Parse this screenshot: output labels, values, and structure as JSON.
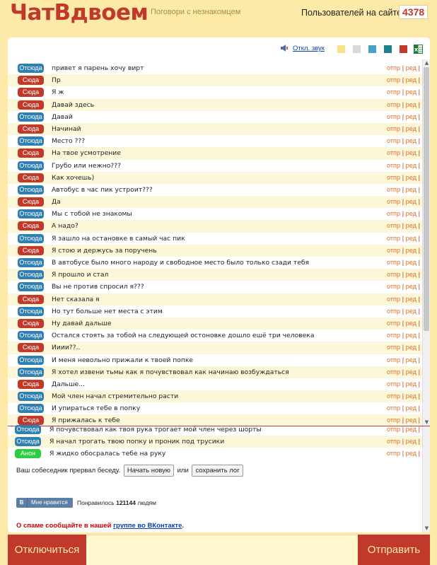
{
  "header": {
    "logo": "ЧатВдвоем",
    "tagline": "Поговори с незнакомцем",
    "users_label": "Пользователей на сайте",
    "users_count": "4378"
  },
  "toolbar": {
    "sound_icon": "speaker-icon",
    "sound_link": "Откл. звук",
    "swatches": [
      "#fbe08a",
      "#d8d8d8",
      "#45a3c9",
      "#1f7f8a",
      "#c0392b"
    ],
    "excel_icon": "excel-icon"
  },
  "labels": {
    "here": "Отсюда",
    "there": "Сюда",
    "anon": "Анон",
    "reply": "отпр",
    "edit": "ред",
    "sep": "|"
  },
  "messages": [
    {
      "who": "Отсюда",
      "text": "привет я парень хочу вирт"
    },
    {
      "who": "Сюда",
      "text": "Пр"
    },
    {
      "who": "Сюда",
      "text": "Я ж"
    },
    {
      "who": "Сюда",
      "text": "Давай здесь"
    },
    {
      "who": "Отсюда",
      "text": "Давай"
    },
    {
      "who": "Сюда",
      "text": "Начинай"
    },
    {
      "who": "Отсюда",
      "text": "Место ???"
    },
    {
      "who": "Сюда",
      "text": "На твое усмотрение"
    },
    {
      "who": "Отсюда",
      "text": "Грубо или нежно???"
    },
    {
      "who": "Сюда",
      "text": "Как хочешь)"
    },
    {
      "who": "Отсюда",
      "text": "Автобус в час пик устроит???"
    },
    {
      "who": "Сюда",
      "text": "Да"
    },
    {
      "who": "Отсюда",
      "text": "Мы с тобой не знакомы"
    },
    {
      "who": "Сюда",
      "text": "А надо?"
    },
    {
      "who": "Отсюда",
      "text": "Я зашло на остановке в самый час пик"
    },
    {
      "who": "Сюда",
      "text": "Я стою и держусь за поручень"
    },
    {
      "who": "Отсюда",
      "text": "В автобусе было много народу и свободное место было только сзади тебя"
    },
    {
      "who": "Отсюда",
      "text": "Я прошло и стал"
    },
    {
      "who": "Отсюда",
      "text": "Вы не против спросил я???"
    },
    {
      "who": "Сюда",
      "text": "Нет сказала я"
    },
    {
      "who": "Отсюда",
      "text": "Но тут больше нет места с этим"
    },
    {
      "who": "Сюда",
      "text": "Ну давай дальше"
    },
    {
      "who": "Отсюда",
      "text": "Остался стоять за тобой на следующей остоновке дошло ешё три человека"
    },
    {
      "who": "Сюда",
      "text": "Ииии??.."
    },
    {
      "who": "Отсюда",
      "text": "И меня невольно прижали к твоей попке"
    },
    {
      "who": "Отсюда",
      "text": "Я хотел извени тьмы как я почувствовал как начинаю возбуждаться"
    },
    {
      "who": "Сюда",
      "text": "Дальше..."
    },
    {
      "who": "Отсюда",
      "text": "Мой член начал стремительно расти"
    },
    {
      "who": "Отсюда",
      "text": "И упираться тебе в попку"
    },
    {
      "who": "Сюда",
      "text": "Я прижалась к тебе"
    }
  ],
  "messages_after": [
    {
      "who": "Отсюда",
      "text": "Я почувствовал как твоя рука трогает мой член через шорты"
    },
    {
      "who": "Отсюда",
      "text": "Я начал трогать твою попку и проник под трусики"
    },
    {
      "who": "Анон",
      "text": "Я жидко обосралась тебе на руку"
    }
  ],
  "end_notice": {
    "text": "Ваш собеседник прервал беседу.",
    "new_button": "Начать новую",
    "or": "или",
    "save_button": "сохранить лог"
  },
  "like": {
    "logo": "В",
    "button": "Мне нравится",
    "prefix": "Понравилось",
    "count": "121144",
    "suffix": "людям"
  },
  "spam": {
    "text": "О спаме сообщайте в нашей",
    "link": "группе во ВКонтакте",
    "end": "."
  },
  "bottom": {
    "disconnect": "Отключиться",
    "send": "Отправить"
  }
}
